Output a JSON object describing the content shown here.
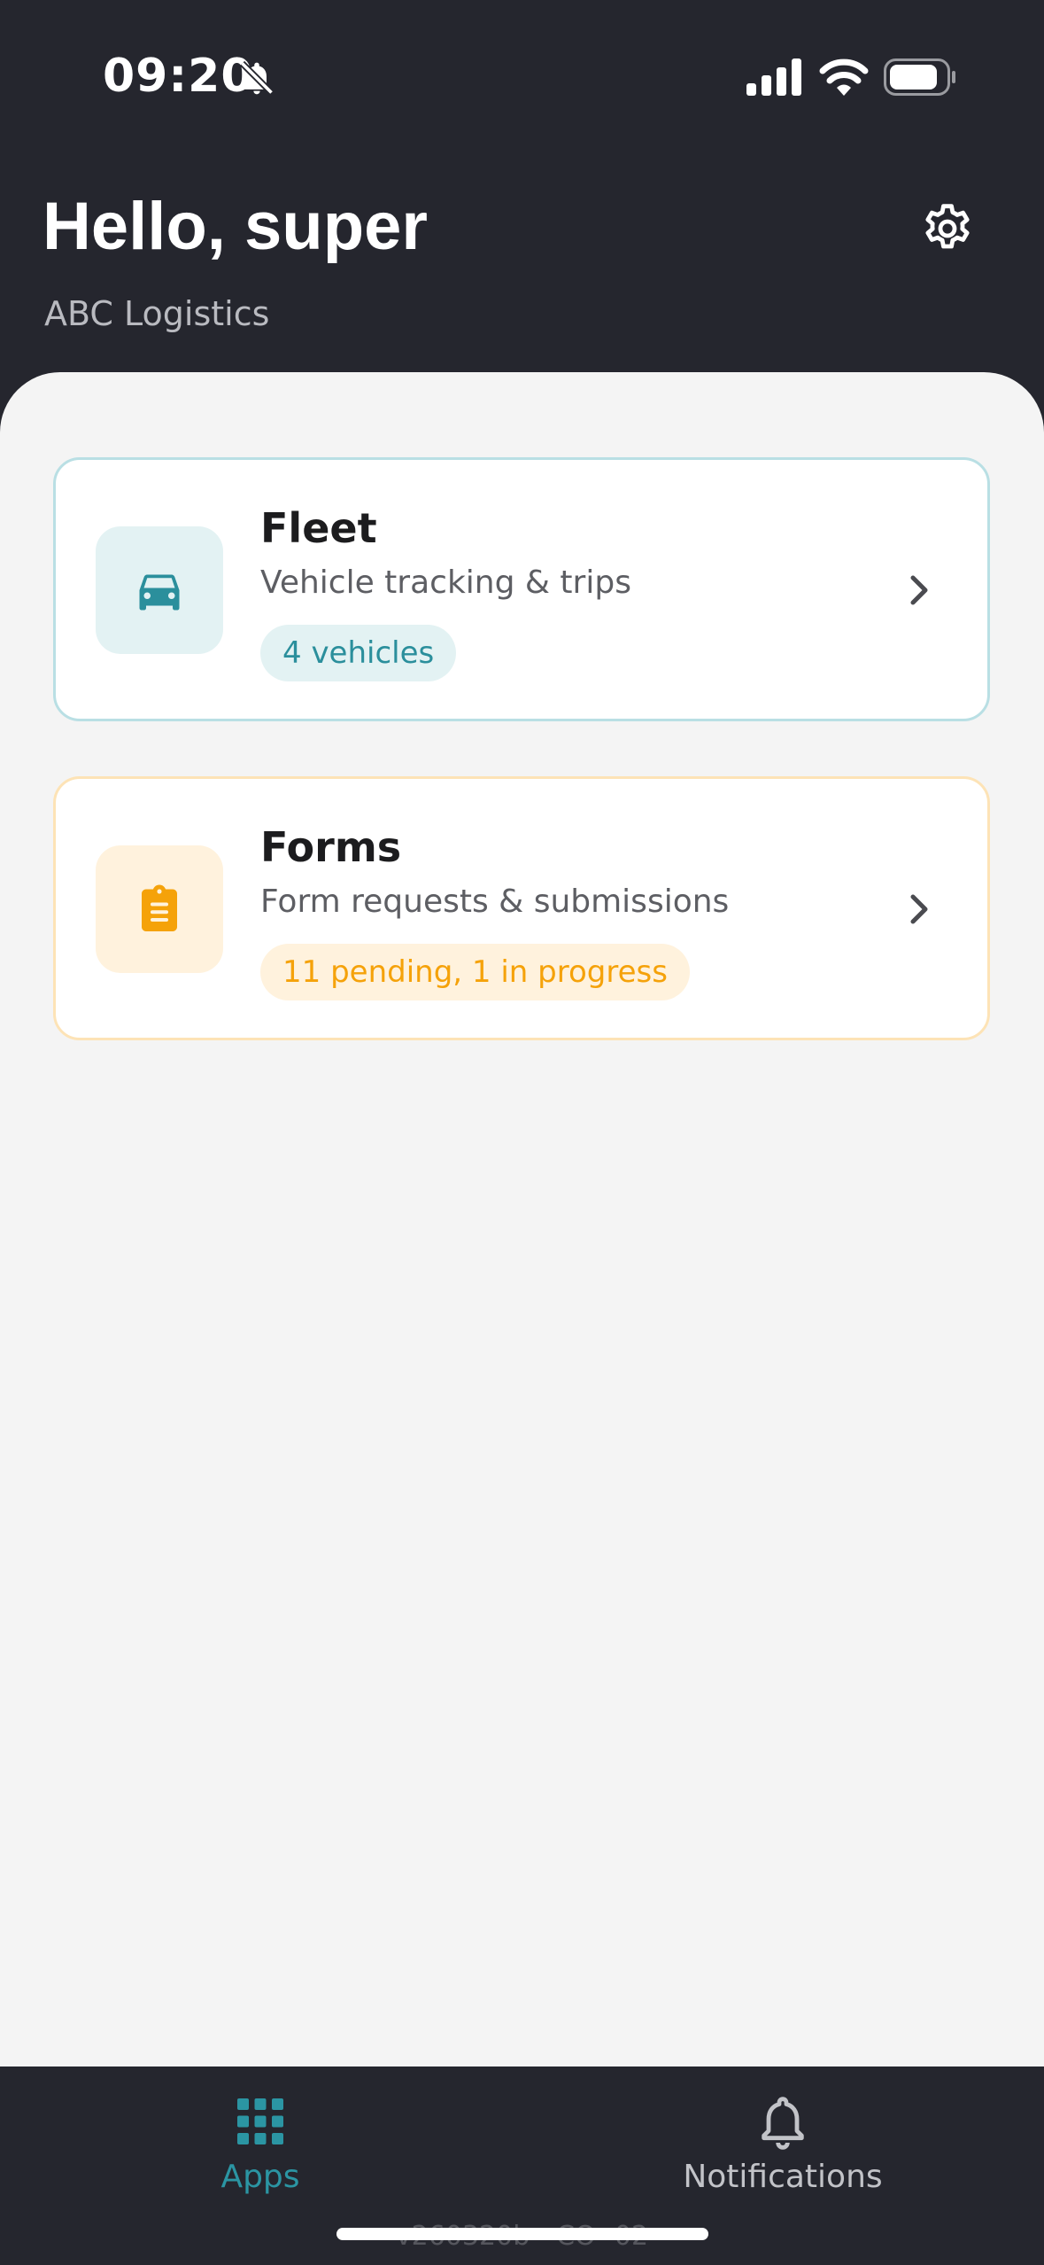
{
  "status_bar": {
    "time": "09:20",
    "icons": [
      "bell-slash-icon",
      "cellular-signal-icon",
      "wifi-icon",
      "battery-icon"
    ]
  },
  "header": {
    "greeting": "Hello, super",
    "organization": "ABC Logistics",
    "settings_icon": "gear-icon"
  },
  "apps": [
    {
      "title": "Fleet",
      "subtitle": "Vehicle tracking & trips",
      "badge": "4 vehicles",
      "icon": "car-icon",
      "accent": "#2b8f9c"
    },
    {
      "title": "Forms",
      "subtitle": "Form requests & submissions",
      "badge": "11 pending, 1 in progress",
      "icon": "clipboard-icon",
      "accent": "#f5a20a"
    }
  ],
  "bottom_nav": {
    "items": [
      {
        "label": "Apps",
        "icon": "grid-icon",
        "active": true
      },
      {
        "label": "Notifications",
        "icon": "bell-icon",
        "active": false
      }
    ]
  },
  "version": "v260320b - CO- 02",
  "colors": {
    "header_bg": "#25262e",
    "sheet_bg": "#f4f4f4",
    "teal": "#2b8f9c",
    "orange": "#f5a20a"
  }
}
